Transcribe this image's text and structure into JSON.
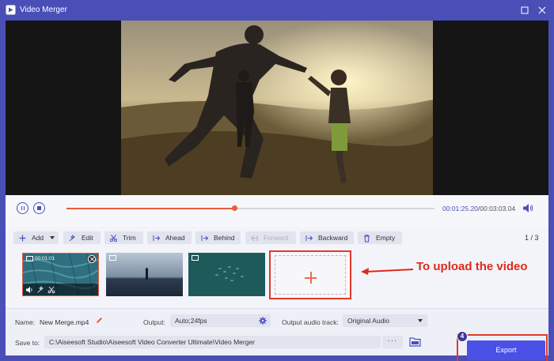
{
  "window": {
    "title": "Video Merger"
  },
  "playback": {
    "current_time": "00:01:25.20",
    "separator": "/",
    "total_time": "00:03:03.04",
    "progress_fraction": 0.458
  },
  "toolbar": {
    "add": "Add",
    "edit": "Edit",
    "trim": "Trim",
    "ahead": "Ahead",
    "behind": "Behind",
    "forward": "Forward",
    "backward": "Backward",
    "empty": "Empty"
  },
  "pagination": "1 / 3",
  "clips": [
    {
      "time": "00:01:01",
      "active": true,
      "scene": "water-texture"
    },
    {
      "scene": "person-on-beach"
    },
    {
      "scene": "fish-school"
    }
  ],
  "annotation": "To upload the video",
  "settings": {
    "name_label": "Name:",
    "name_value": "New Merge.mp4",
    "output_label": "Output:",
    "output_value": "Auto;24fps",
    "audio_label": "Output audio track:",
    "audio_value": "Original Audio",
    "save_label": "Save to:",
    "save_path": "C:\\Aiseesoft Studio\\Aiseesoft Video Converter Ultimate\\Video Merger",
    "browse": "···"
  },
  "export": {
    "label": "Export",
    "step": "4"
  },
  "colors": {
    "accent": "#4a4fb8",
    "progress": "#ec5a3c",
    "highlight": "#e03a2a",
    "export": "#4b50e6"
  }
}
